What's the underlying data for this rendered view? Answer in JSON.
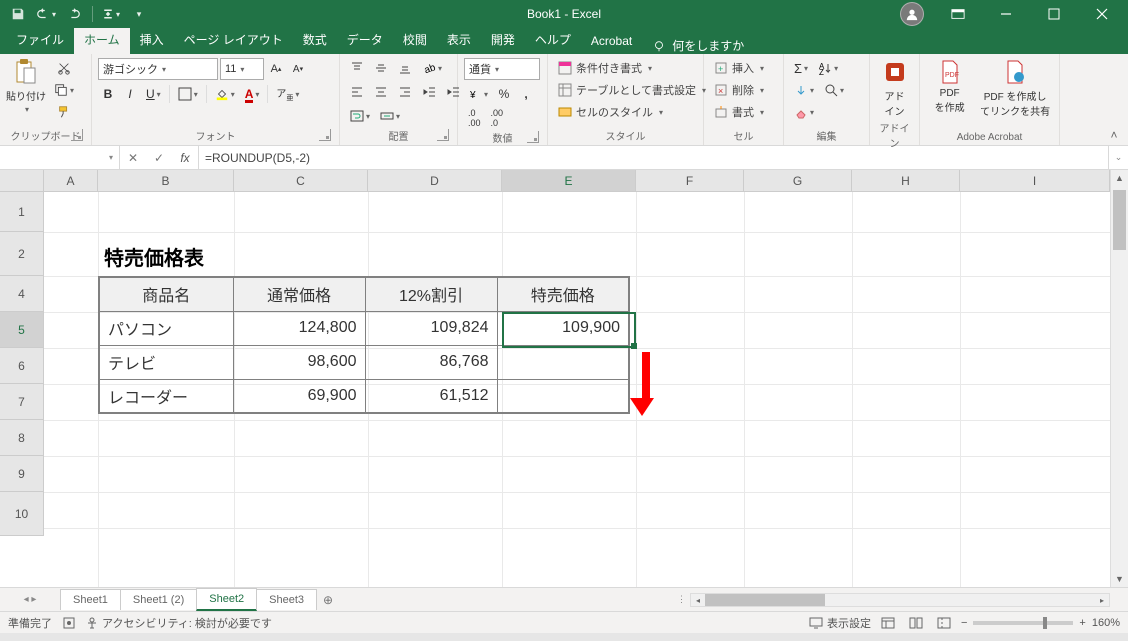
{
  "app": {
    "title": "Book1 - Excel"
  },
  "tabs": {
    "file": "ファイル",
    "home": "ホーム",
    "insert": "挿入",
    "pagelayout": "ページ レイアウト",
    "formulas": "数式",
    "data": "データ",
    "review": "校閲",
    "view": "表示",
    "developer": "開発",
    "help": "ヘルプ",
    "acrobat": "Acrobat",
    "tellme": "何をしますか"
  },
  "ribbon": {
    "clipboard": {
      "label": "クリップボード",
      "paste": "貼り付け"
    },
    "font": {
      "label": "フォント",
      "name": "游ゴシック",
      "size": "11"
    },
    "alignment": {
      "label": "配置"
    },
    "number": {
      "label": "数値",
      "format": "通貨"
    },
    "styles": {
      "label": "スタイル",
      "conditional": "条件付き書式",
      "table": "テーブルとして書式設定",
      "cell": "セルのスタイル"
    },
    "cells": {
      "label": "セル",
      "insert": "挿入",
      "delete": "削除",
      "format": "書式"
    },
    "editing": {
      "label": "編集"
    },
    "addin": {
      "label": "アドイン",
      "btn": "アド\nイン"
    },
    "acrobat": {
      "label": "Adobe Acrobat",
      "create": "PDF\nを作成",
      "share": "PDF を作成し\nてリンクを共有"
    }
  },
  "formula_bar": {
    "name_box": "",
    "formula": "=ROUNDUP(D5,-2)"
  },
  "columns": [
    "A",
    "B",
    "C",
    "D",
    "E",
    "F",
    "G",
    "H",
    "I"
  ],
  "rows_visible": [
    "1",
    "2",
    "4",
    "5",
    "6",
    "7",
    "8",
    "9",
    "10"
  ],
  "selected_cell": "E5",
  "sheet": {
    "title": "特売価格表",
    "headers": {
      "b": "商品名",
      "c": "通常価格",
      "d": "12%割引",
      "e": "特売価格"
    },
    "rows": [
      {
        "b": "パソコン",
        "c": "124,800",
        "d": "109,824",
        "e": "109,900"
      },
      {
        "b": "テレビ",
        "c": "98,600",
        "d": "86,768",
        "e": ""
      },
      {
        "b": "レコーダー",
        "c": "69,900",
        "d": "61,512",
        "e": ""
      }
    ]
  },
  "chart_data": {
    "type": "table",
    "title": "特売価格表",
    "columns": [
      "商品名",
      "通常価格",
      "12%割引",
      "特売価格"
    ],
    "rows": [
      [
        "パソコン",
        124800,
        109824,
        109900
      ],
      [
        "テレビ",
        98600,
        86768,
        null
      ],
      [
        "レコーダー",
        69900,
        61512,
        null
      ]
    ],
    "formula_E5": "=ROUNDUP(D5,-2)"
  },
  "sheet_tabs": {
    "t1": "Sheet1",
    "t2": "Sheet1 (2)",
    "t3": "Sheet2",
    "t4": "Sheet3",
    "active": "Sheet2"
  },
  "statusbar": {
    "ready": "準備完了",
    "accessibility": "アクセシビリティ: 検討が必要です",
    "display_settings": "表示設定",
    "zoom": "160%"
  }
}
